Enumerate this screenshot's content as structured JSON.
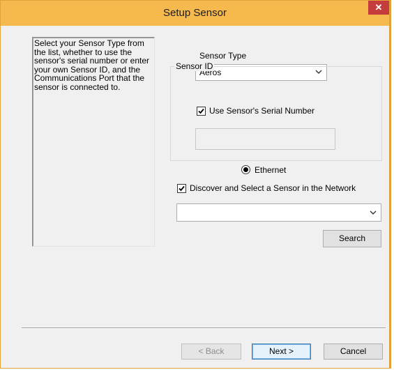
{
  "window": {
    "title": "Setup Sensor",
    "close_glyph": "✕"
  },
  "info_text": "Select your Sensor Type from the list, whether to use the sensor's serial number or enter your own Sensor ID, and the Communications Port that the sensor is connected to.",
  "sensor_type": {
    "label": "Sensor Type",
    "selected": "Aeros"
  },
  "sensor_id": {
    "group_label": "Sensor ID",
    "use_serial_label": "Use Sensor's Serial Number",
    "use_serial_checked": true,
    "serial_value": ""
  },
  "connection": {
    "ethernet_label": "Ethernet",
    "ethernet_selected": true
  },
  "discover": {
    "label": "Discover and Select a Sensor in the Network",
    "checked": true,
    "selected": ""
  },
  "buttons": {
    "search": "Search",
    "back": "< Back",
    "next": "Next >",
    "cancel": "Cancel"
  },
  "icons": {
    "checkbox": "check-mark",
    "dropdown": "chevron-down-icon"
  },
  "colors": {
    "titlebar": "#f6b94d",
    "close": "#c43c3c",
    "window_bg": "#f0f0f0"
  }
}
